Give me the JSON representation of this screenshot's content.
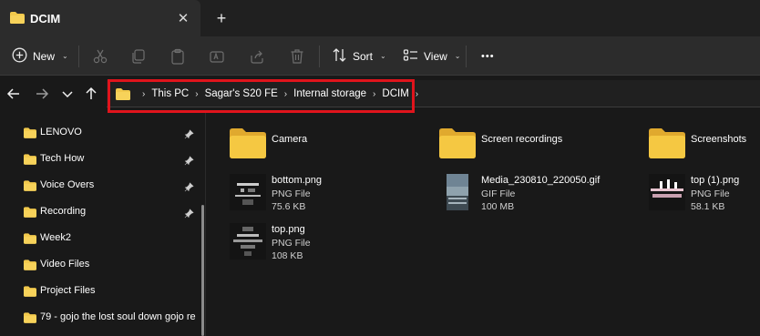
{
  "tab": {
    "title": "DCIM",
    "close_glyph": "✕",
    "new_tab_glyph": "+"
  },
  "commandbar": {
    "new_label": "New",
    "sort_label": "Sort",
    "view_label": "View",
    "more_glyph": "•••",
    "icons": [
      "plus-circle-icon",
      "cut-icon",
      "copy-icon",
      "paste-icon",
      "rename-icon",
      "share-icon",
      "delete-icon",
      "sort-icon",
      "view-icon"
    ]
  },
  "navigation": {
    "icons": [
      "back-arrow-icon",
      "forward-arrow-icon",
      "recent-chevron-icon",
      "up-arrow-icon"
    ]
  },
  "breadcrumb": {
    "items": [
      "This PC",
      "Sagar's S20 FE",
      "Internal storage",
      "DCIM"
    ],
    "separator": "›"
  },
  "sidebar": {
    "items": [
      {
        "label": "LENOVO",
        "pinned": true
      },
      {
        "label": "Tech How",
        "pinned": true
      },
      {
        "label": "Voice Overs",
        "pinned": true
      },
      {
        "label": "Recording",
        "pinned": true
      },
      {
        "label": "Week2",
        "pinned": false
      },
      {
        "label": "Video Files",
        "pinned": false
      },
      {
        "label": "Project Files",
        "pinned": false
      },
      {
        "label": "79 - gojo the lost soul down gojo re",
        "pinned": false
      }
    ]
  },
  "content": {
    "folders": [
      {
        "name": "Camera"
      },
      {
        "name": "Screen recordings"
      },
      {
        "name": "Screenshots"
      }
    ],
    "files": [
      {
        "name": "bottom.png",
        "type": "PNG File",
        "size": "75.6 KB"
      },
      {
        "name": "Media_230810_220050.gif",
        "type": "GIF File",
        "size": "100 MB"
      },
      {
        "name": "top (1).png",
        "type": "PNG File",
        "size": "58.1 KB"
      },
      {
        "name": "top.png",
        "type": "PNG File",
        "size": "108 KB"
      }
    ]
  },
  "colors": {
    "folder": "#f2c94c",
    "highlight_border": "#e0141c",
    "background": "#191919",
    "commandbar": "#2c2c2c"
  }
}
